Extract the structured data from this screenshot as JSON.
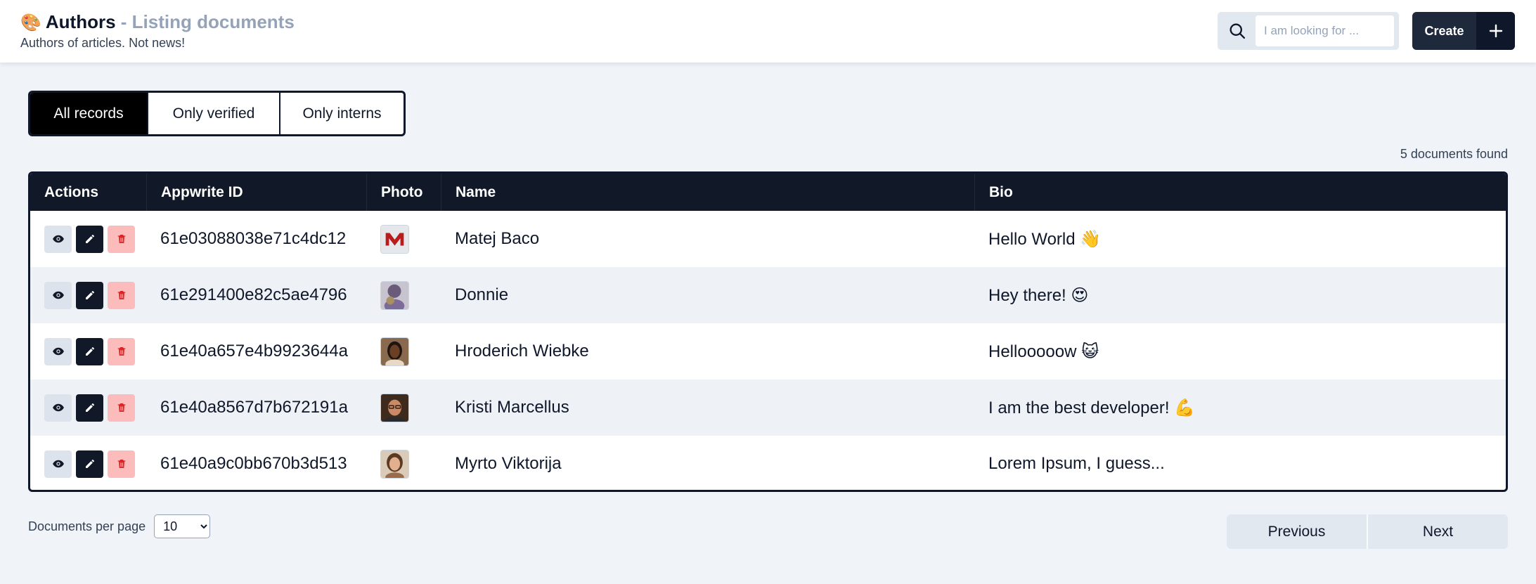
{
  "header": {
    "emoji": "🎨",
    "title": "Authors",
    "separator": " - ",
    "title_suffix": "Listing documents",
    "subtitle": "Authors of articles. Not news!",
    "search_placeholder": "I am looking for ...",
    "search_icon": "search-icon",
    "create_label": "Create",
    "create_icon": "plus-icon"
  },
  "filters": {
    "tabs": [
      {
        "label": "All records",
        "active": true
      },
      {
        "label": "Only verified",
        "active": false
      },
      {
        "label": "Only interns",
        "active": false
      }
    ]
  },
  "results": {
    "count_text": "5 documents found"
  },
  "table": {
    "columns": [
      "Actions",
      "Appwrite ID",
      "Photo",
      "Name",
      "Bio"
    ],
    "rows": [
      {
        "id": "61e03088038e71c4dc12",
        "name": "Matej Baco",
        "bio": "Hello World 👋",
        "photo": "logo-m"
      },
      {
        "id": "61e291400e82c5ae4796",
        "name": "Donnie",
        "bio": "Hey there! 😍",
        "photo": "avatar-purple"
      },
      {
        "id": "61e40a657e4b9923644a",
        "name": "Hroderich Wiebke",
        "bio": "Hellooooow 😺",
        "photo": "avatar-dark"
      },
      {
        "id": "61e40a8567d7b672191a",
        "name": "Kristi Marcellus",
        "bio": "I am the best developer! 💪",
        "photo": "avatar-glasses"
      },
      {
        "id": "61e40a9c0bb670b3d513",
        "name": "Myrto Viktorija",
        "bio": "Lorem Ipsum, I guess...",
        "photo": "avatar-light"
      }
    ],
    "action_icons": [
      "eye-icon",
      "pencil-icon",
      "trash-icon"
    ]
  },
  "footer": {
    "per_page_label": "Documents per page",
    "per_page_value": "10",
    "previous_label": "Previous",
    "next_label": "Next"
  },
  "colors": {
    "accent": "#111827",
    "delete": "#fcbcbc",
    "muted": "#94a3b8",
    "background": "#f0f3f8"
  }
}
